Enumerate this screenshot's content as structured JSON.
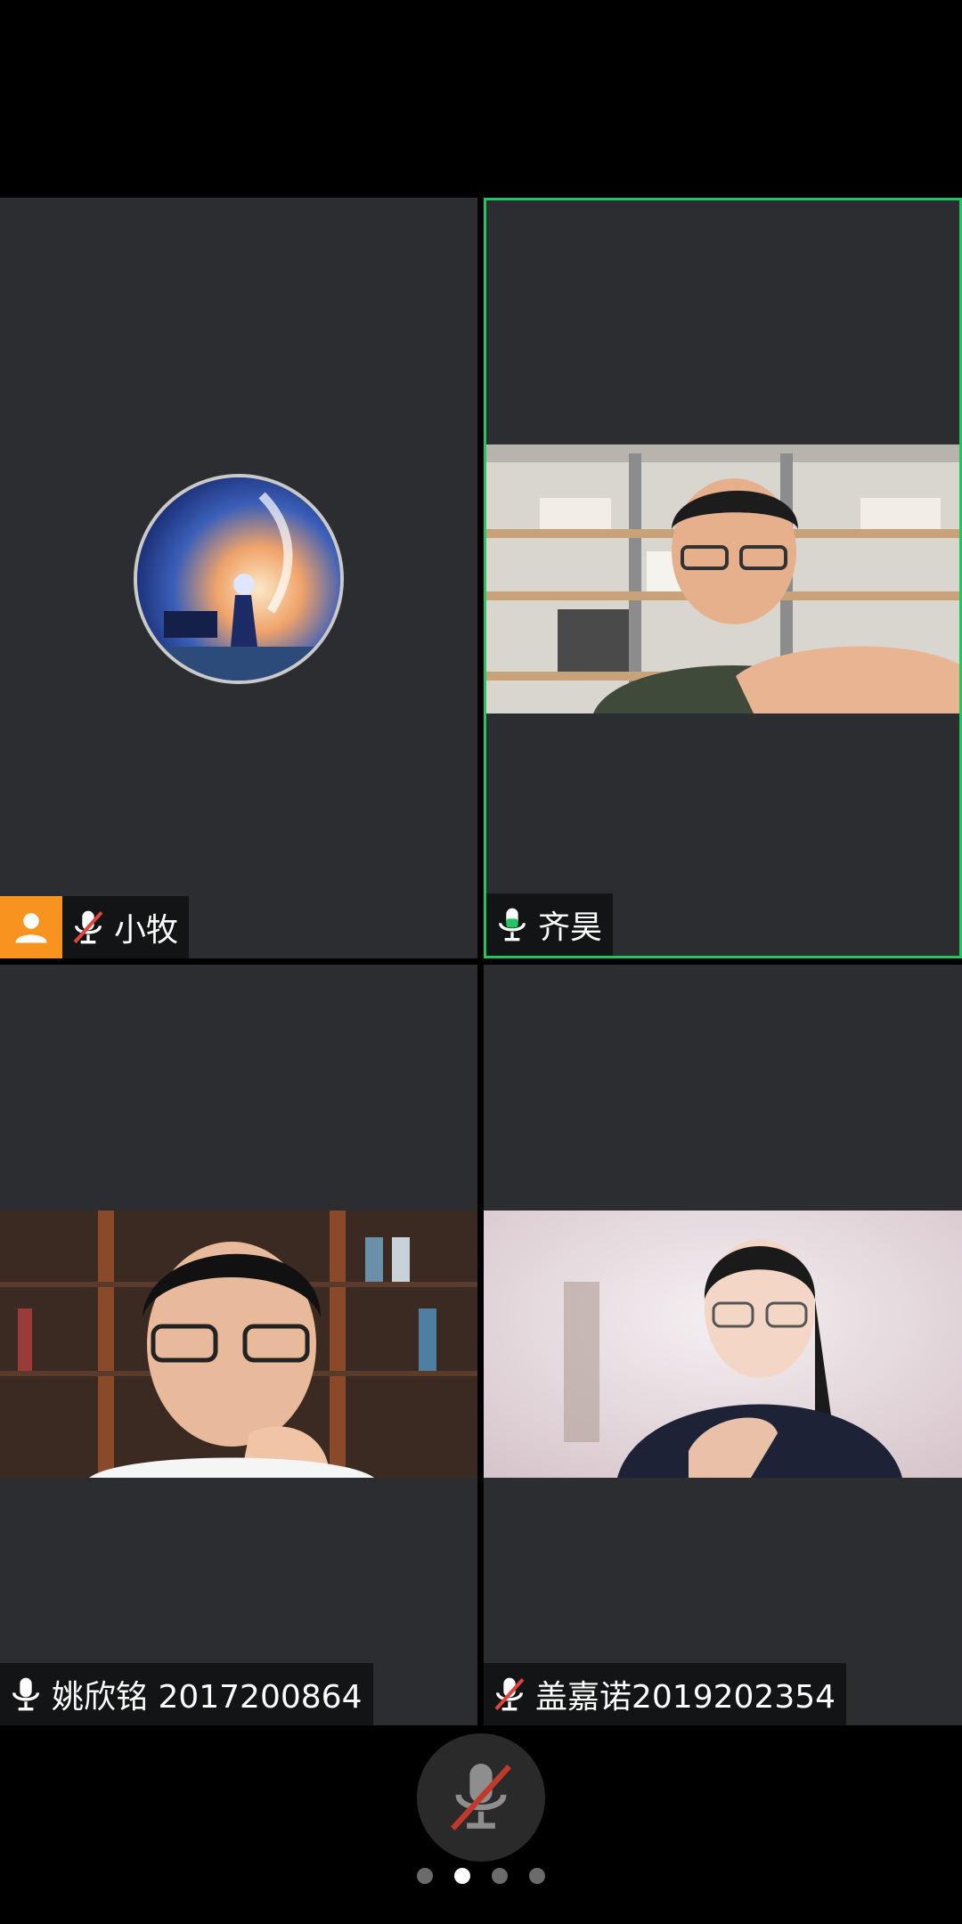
{
  "colors": {
    "accent_active": "#22c55e",
    "host": "#f7931e",
    "muted_slash": "#e0443a",
    "tile_bg": "#2b2d30"
  },
  "participants": [
    {
      "name": "小牧",
      "mic": "muted",
      "host": true,
      "video": "avatar"
    },
    {
      "name": "齐昊",
      "mic": "on",
      "host": false,
      "video": "camera",
      "active_speaker": true
    },
    {
      "name": "姚欣铭 2017200864",
      "mic": "on",
      "host": false,
      "video": "camera"
    },
    {
      "name": "盖嘉诺2019202354",
      "mic": "muted",
      "host": false,
      "video": "camera"
    }
  ],
  "controls": {
    "mute_button_icon": "mic-muted-icon"
  },
  "pager": {
    "pages": 4,
    "current": 2
  }
}
